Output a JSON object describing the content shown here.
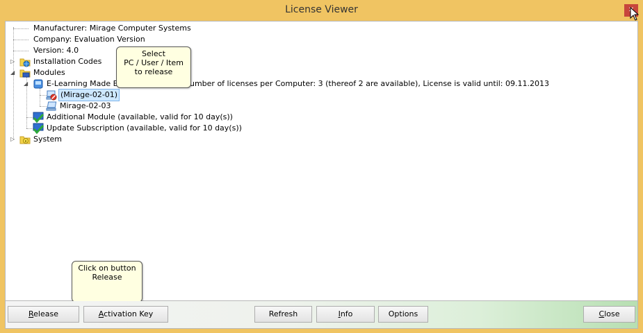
{
  "window": {
    "title": "License Viewer"
  },
  "tree": {
    "manufacturer": "Manufacturer: Mirage Computer Systems",
    "company": "Company: Evaluation Version",
    "version": "Version: 4.0",
    "installation_codes": "Installation Codes",
    "modules": "Modules",
    "module_prefix": "E-Learning Made Eas",
    "module_suffix": "umber of licenses per Computer: 3 (thereof 2 are available), License is valid until: 09.11.2013",
    "pc_selected": "(Mirage-02-01)",
    "pc_other": "Mirage-02-03",
    "additional_module": "Additional Module (available, valid for 10 day(s))",
    "update_subscription": "Update Subscription (available, valid for 10 day(s))",
    "system": "System"
  },
  "callouts": {
    "select": [
      "Select",
      "PC / User / Item",
      "to release"
    ],
    "release": [
      "Click on button",
      "Release"
    ]
  },
  "buttons": {
    "release": {
      "pre": "",
      "accel": "R",
      "post": "elease"
    },
    "activation_key": {
      "pre": "",
      "accel": "A",
      "post": "ctivation Key"
    },
    "refresh": {
      "pre": "Refresh",
      "accel": "",
      "post": ""
    },
    "info": {
      "pre": "",
      "accel": "I",
      "post": "nfo"
    },
    "options": {
      "pre": "Options",
      "accel": "",
      "post": ""
    },
    "close": {
      "pre": "",
      "accel": "C",
      "post": "lose"
    }
  },
  "colors": {
    "frame": "#f0c462",
    "close_button": "#c7453c",
    "selection": "#cde8ff",
    "callout_bg": "#ffffe1"
  },
  "icons": {
    "installation_codes": "folder-globe-icon",
    "modules": "folder-icon",
    "module": "module-icon",
    "pc_selected": "computer-blocked-icon",
    "pc_other": "computer-icon",
    "checked_module": "green-check-icon",
    "system": "folder-info-icon"
  }
}
